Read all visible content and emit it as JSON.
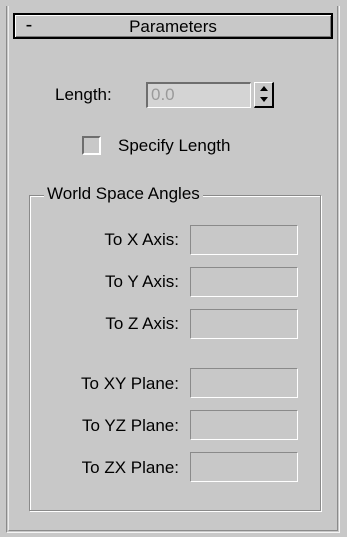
{
  "rollout": {
    "collapse_symbol": "-",
    "title": "Parameters"
  },
  "length": {
    "label": "Length:",
    "value": "0.0",
    "spinner_icon": "up-down-spinner"
  },
  "specify_length": {
    "label": "Specify Length",
    "checked": false
  },
  "world_space_angles": {
    "group_title": "World Space Angles",
    "axes": [
      {
        "label": "To X Axis:",
        "value": ""
      },
      {
        "label": "To Y Axis:",
        "value": ""
      },
      {
        "label": "To Z Axis:",
        "value": ""
      }
    ],
    "planes": [
      {
        "label": "To XY Plane:",
        "value": ""
      },
      {
        "label": "To YZ Plane:",
        "value": ""
      },
      {
        "label": "To ZX Plane:",
        "value": ""
      }
    ]
  }
}
